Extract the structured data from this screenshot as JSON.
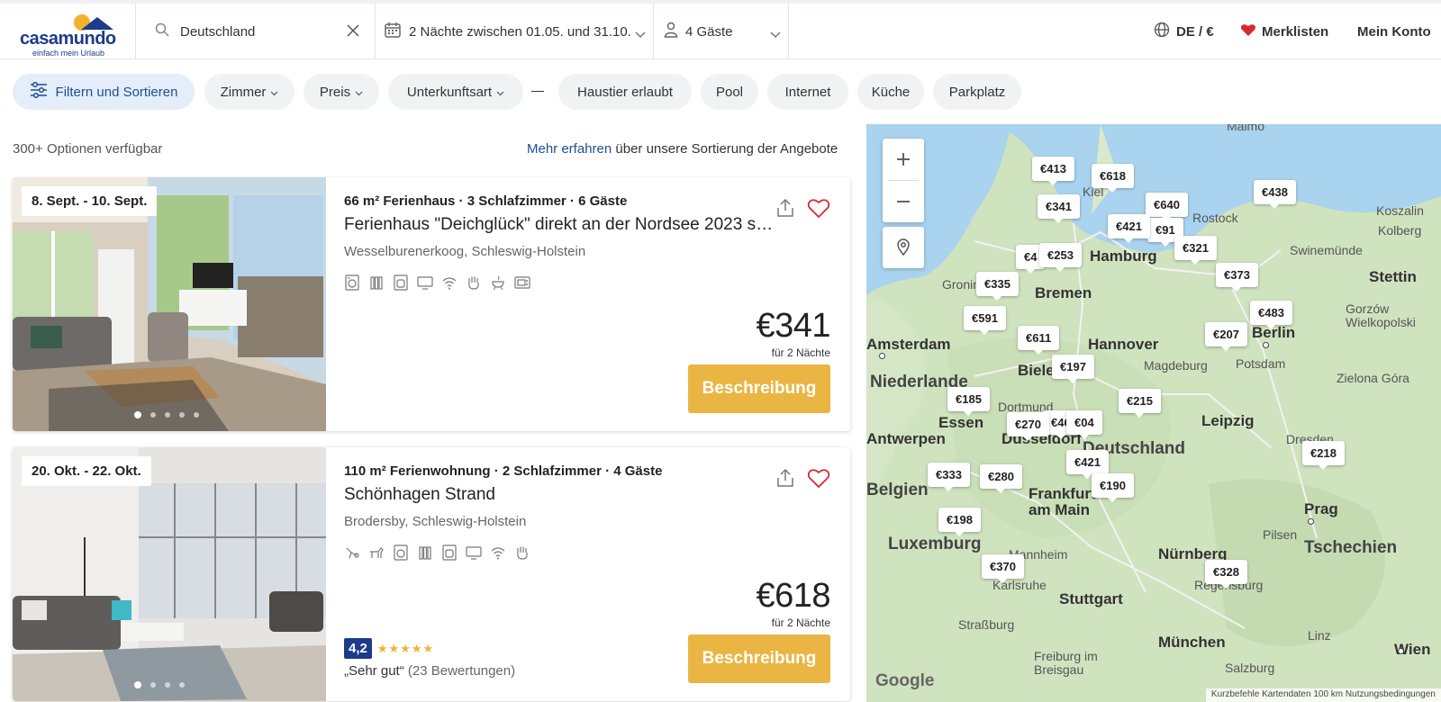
{
  "brand": {
    "name": "casamundo",
    "tagline": "einfach mein Urlaub"
  },
  "header": {
    "search_value": "Deutschland",
    "dates_label": "2 Nächte zwischen 01.05. und 31.10.",
    "guests_label": "4 Gäste",
    "locale": "DE / €",
    "wishlists": "Merklisten",
    "account": "Mein Konto"
  },
  "filters": {
    "filter_sort": "Filtern und Sortieren",
    "rooms": "Zimmer",
    "price": "Preis",
    "type": "Unterkunftsart",
    "pets": "Haustier erlaubt",
    "pool": "Pool",
    "internet": "Internet",
    "kitchen": "Küche",
    "parking": "Parkplatz"
  },
  "list": {
    "count": "300+ Optionen verfügbar",
    "sort_link": "Mehr erfahren",
    "sort_text": " über unsere Sortierung der Angebote",
    "cards": [
      {
        "date_badge": "8. Sept. - 10. Sept.",
        "meta": "66 m² Ferienhaus · 3 Schlafzimmer · 6 Gäste",
        "title": "Ferienhaus \"Deichglück\" direkt an der Nordsee 2023 sa...",
        "location": "Wesselburenerkoog, Schleswig-Holstein",
        "price": "€341",
        "per": "für 2 Nächte",
        "button": "Beschreibung"
      },
      {
        "date_badge": "20. Okt. - 22. Okt.",
        "meta": "110 m² Ferienwohnung · 2 Schlafzimmer · 4 Gäste",
        "title": "Schönhagen Strand",
        "location": "Brodersby, Schleswig-Holstein",
        "price": "€618",
        "per": "für 2 Nächte",
        "button": "Beschreibung",
        "rating": "4,2",
        "rating_value": 4.2,
        "rating_text": "„Sehr gut“",
        "rating_count": "(23 Bewertungen)"
      }
    ]
  },
  "map": {
    "pins": [
      "€413",
      "€618",
      "€438",
      "€341",
      "€640",
      "€421",
      "€91",
      "€321",
      "€4",
      "€253",
      "€373",
      "€335",
      "€591",
      "€483",
      "€207",
      "€611",
      "€197",
      "€185",
      "€215",
      "€270",
      "€46",
      "€04",
      "€421",
      "€218",
      "€333",
      "€280",
      "€190",
      "€198",
      "€370",
      "€328"
    ],
    "cities": [
      "Kiel",
      "Rostock",
      "Koszalin",
      "Kolberg",
      "Swinemünde",
      "Stettin",
      "Hamburg",
      "Groningen",
      "Bremen",
      "Gorzów Wielkopolski",
      "Berlin",
      "Potsdam",
      "Hannover",
      "Magdeburg",
      "Bielefeld",
      "Amsterdam",
      "Niederlande",
      "Zielona Góra",
      "Essen",
      "Dortmund",
      "Düsseldorf",
      "Leipzig",
      "Deutschland",
      "Antwerpen",
      "Dresden",
      "Frankfurt am Main",
      "Prag",
      "Belgien",
      "Luxemburg",
      "Pilsen",
      "Tschechien",
      "Mannheim",
      "Nürnberg",
      "Karlsruhe",
      "Stuttgart",
      "Regensburg",
      "Straßburg",
      "München",
      "Linz",
      "Freiburg im Breisgau",
      "Salzburg",
      "Wien",
      "Malmö"
    ],
    "attribution": "Kurzbefehle  Kartendaten  100 km  Nutzungsbedingungen",
    "google": "Google"
  },
  "colors": {
    "brand": "#1c3b8a",
    "accent": "#eab542",
    "heart": "#d8282f",
    "chip": "#f1f2f4"
  }
}
